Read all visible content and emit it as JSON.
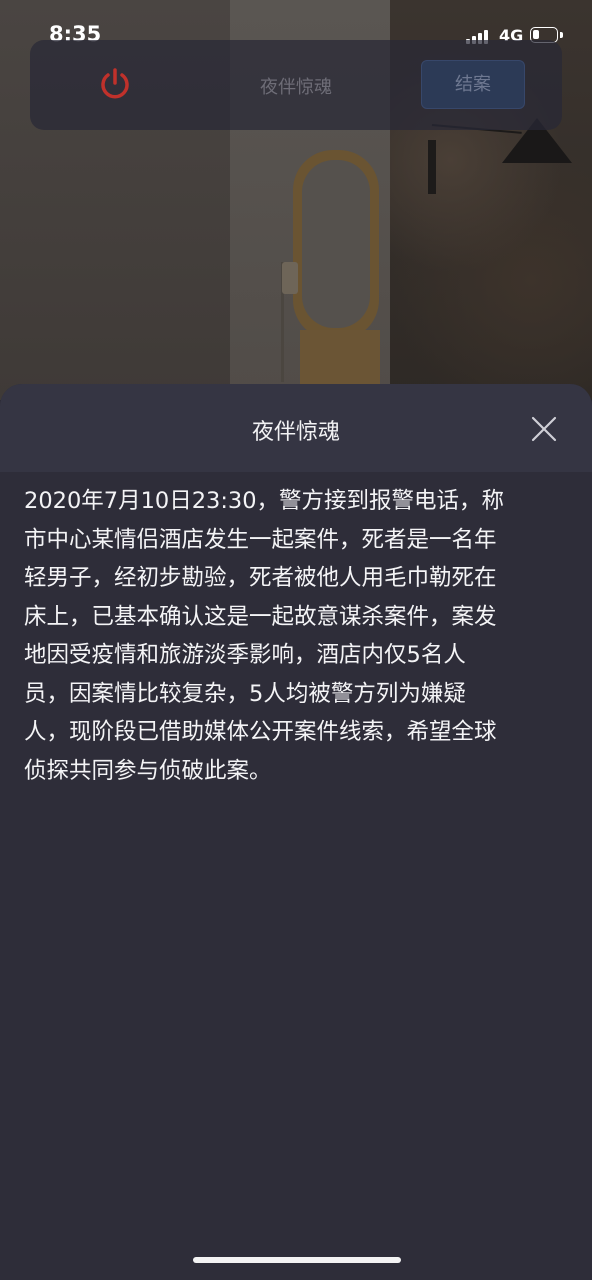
{
  "status_bar": {
    "time": "8:35",
    "network": "4G"
  },
  "topbar": {
    "title": "夜伴惊魂",
    "close_case_label": "结案",
    "power_color": "#c0312b"
  },
  "sheet": {
    "title": "夜伴惊魂",
    "lines": [
      "2020年7月10日23:30，警方接到报警电话，称",
      "市中心某情侣酒店发生一起案件，死者是一名年",
      "轻男子，经初步勘验，死者被他人用毛巾勒死在",
      "床上，已基本确认这是一起故意谋杀案件，案发",
      "地因受疫情和旅游淡季影响，酒店内仅5名人",
      "员，因案情比较复杂，5人均被警方列为嫌疑",
      "人，现阶段已借助媒体公开案件线索，希望全球",
      "侦探共同参与侦破此案。"
    ]
  },
  "icons": {
    "power": "power-icon",
    "close": "close-icon",
    "signal": "signal-icon",
    "battery": "battery-icon"
  }
}
